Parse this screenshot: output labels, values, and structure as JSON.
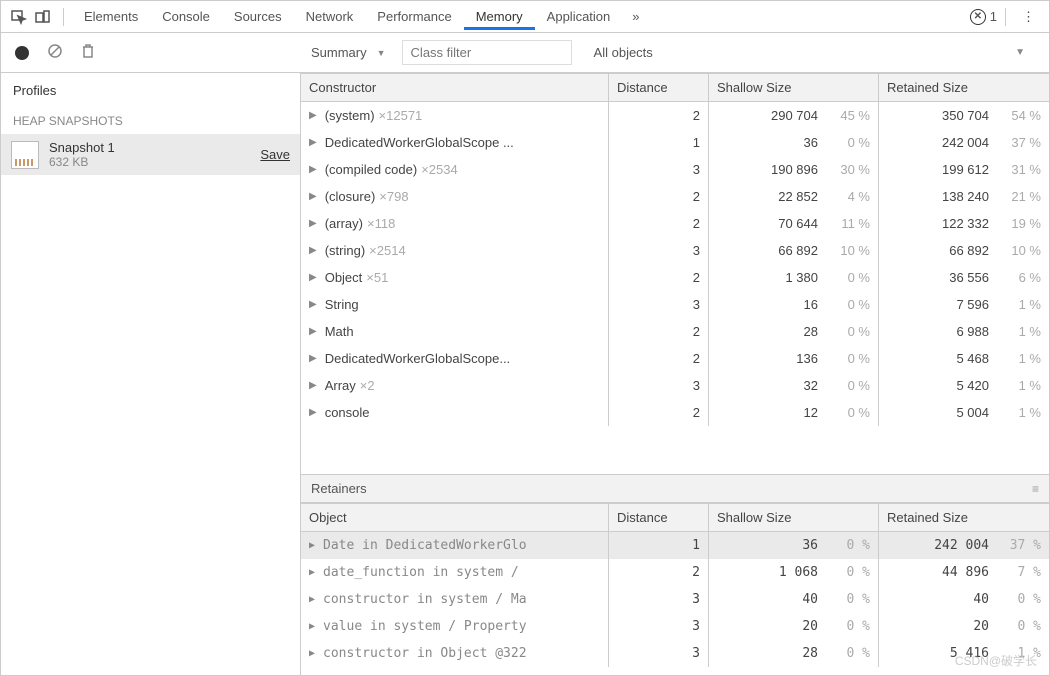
{
  "tabs": [
    "Elements",
    "Console",
    "Sources",
    "Network",
    "Performance",
    "Memory",
    "Application"
  ],
  "active_tab": "Memory",
  "more": "»",
  "errors": {
    "count": "1"
  },
  "toolbar": {
    "summary_label": "Summary",
    "filter_placeholder": "Class filter",
    "objects_label": "All objects"
  },
  "sidebar": {
    "profiles_label": "Profiles",
    "category": "HEAP SNAPSHOTS",
    "snapshot": {
      "name": "Snapshot 1",
      "size": "632 KB",
      "save": "Save"
    }
  },
  "constructors": {
    "headers": {
      "c1": "Constructor",
      "c2": "Distance",
      "c3": "Shallow Size",
      "c4": "Retained Size"
    },
    "rows": [
      {
        "name": "(system)",
        "mult": "×12571",
        "dist": "2",
        "shallow": "290 704",
        "spct": "45 %",
        "retained": "350 704",
        "rpct": "54 %"
      },
      {
        "name": "DedicatedWorkerGlobalScope ...",
        "mult": "",
        "dist": "1",
        "shallow": "36",
        "spct": "0 %",
        "retained": "242 004",
        "rpct": "37 %"
      },
      {
        "name": "(compiled code)",
        "mult": "×2534",
        "dist": "3",
        "shallow": "190 896",
        "spct": "30 %",
        "retained": "199 612",
        "rpct": "31 %"
      },
      {
        "name": "(closure)",
        "mult": "×798",
        "dist": "2",
        "shallow": "22 852",
        "spct": "4 %",
        "retained": "138 240",
        "rpct": "21 %"
      },
      {
        "name": "(array)",
        "mult": "×118",
        "dist": "2",
        "shallow": "70 644",
        "spct": "11 %",
        "retained": "122 332",
        "rpct": "19 %"
      },
      {
        "name": "(string)",
        "mult": "×2514",
        "dist": "3",
        "shallow": "66 892",
        "spct": "10 %",
        "retained": "66 892",
        "rpct": "10 %"
      },
      {
        "name": "Object",
        "mult": "×51",
        "dist": "2",
        "shallow": "1 380",
        "spct": "0 %",
        "retained": "36 556",
        "rpct": "6 %"
      },
      {
        "name": "String",
        "mult": "",
        "dist": "3",
        "shallow": "16",
        "spct": "0 %",
        "retained": "7 596",
        "rpct": "1 %"
      },
      {
        "name": "Math",
        "mult": "",
        "dist": "2",
        "shallow": "28",
        "spct": "0 %",
        "retained": "6 988",
        "rpct": "1 %"
      },
      {
        "name": "DedicatedWorkerGlobalScope...",
        "mult": "",
        "dist": "2",
        "shallow": "136",
        "spct": "0 %",
        "retained": "5 468",
        "rpct": "1 %"
      },
      {
        "name": "Array",
        "mult": "×2",
        "dist": "3",
        "shallow": "32",
        "spct": "0 %",
        "retained": "5 420",
        "rpct": "1 %"
      },
      {
        "name": "console",
        "mult": "",
        "dist": "2",
        "shallow": "12",
        "spct": "0 %",
        "retained": "5 004",
        "rpct": "1 %"
      }
    ]
  },
  "retainers": {
    "title": "Retainers",
    "headers": {
      "c1": "Object",
      "c2": "Distance",
      "c3": "Shallow Size",
      "c4": "Retained Size"
    },
    "rows": [
      {
        "name": "Date in DedicatedWorkerGlo",
        "dist": "1",
        "shallow": "36",
        "spct": "0 %",
        "retained": "242 004",
        "rpct": "37 %",
        "sel": true
      },
      {
        "name": "date_function in system /",
        "dist": "2",
        "shallow": "1 068",
        "spct": "0 %",
        "retained": "44 896",
        "rpct": "7 %"
      },
      {
        "name": "constructor in system / Ma",
        "dist": "3",
        "shallow": "40",
        "spct": "0 %",
        "retained": "40",
        "rpct": "0 %"
      },
      {
        "name": "value in system / Property",
        "dist": "3",
        "shallow": "20",
        "spct": "0 %",
        "retained": "20",
        "rpct": "0 %"
      },
      {
        "name": "constructor in Object @322",
        "dist": "3",
        "shallow": "28",
        "spct": "0 %",
        "retained": "5 416",
        "rpct": "1 %"
      }
    ]
  },
  "watermark": "CSDN@破学长"
}
